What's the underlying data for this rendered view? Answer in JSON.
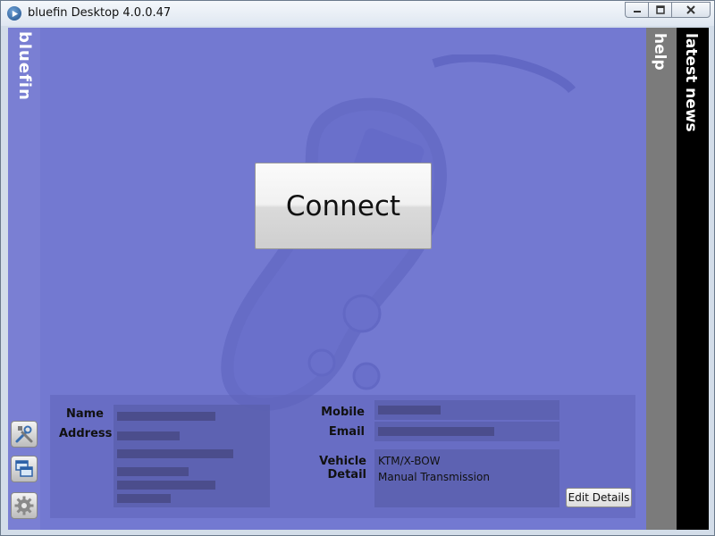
{
  "window": {
    "title": "bluefin Desktop 4.0.0.47",
    "controls": [
      "minimize-icon",
      "maximize-icon",
      "close-icon"
    ]
  },
  "sidebar": {
    "brand": "bluefin",
    "buttons": [
      {
        "icon": "tools-icon"
      },
      {
        "icon": "windows-icon"
      },
      {
        "icon": "gear-icon"
      }
    ]
  },
  "main": {
    "connect_label": "Connect"
  },
  "details": {
    "name_label": "Name",
    "address_label": "Address",
    "mobile_label": "Mobile",
    "email_label": "Email",
    "vehicle_label": "Vehicle Detail",
    "vehicle_lines": [
      "KTM/X-BOW",
      "Manual Transmission"
    ],
    "edit_label": "Edit Details"
  },
  "right_tabs": {
    "help": "help",
    "news": "latest news"
  },
  "colors": {
    "background": "#7379d1",
    "help_strip": "#7b7b7b",
    "news_strip": "#000000"
  }
}
